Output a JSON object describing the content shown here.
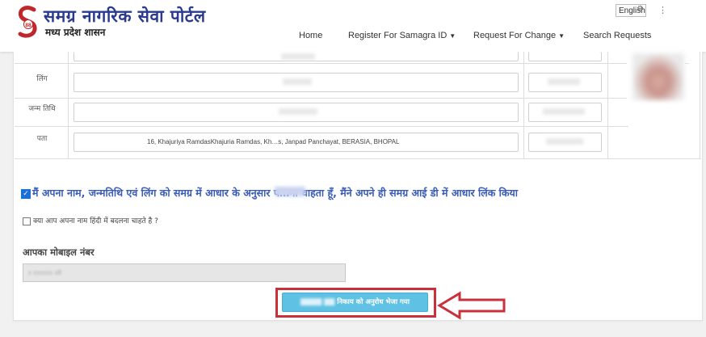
{
  "header": {
    "title": "समग्र नागरिक सेवा पोर्टल",
    "subtitle": "मध्य प्रदेश शासन",
    "logo_text": "88",
    "language_button": "English"
  },
  "nav": {
    "items": [
      {
        "label": "Home"
      },
      {
        "label": "Register For Samagra ID"
      },
      {
        "label": "Request For Change"
      },
      {
        "label": "Search Requests"
      }
    ]
  },
  "form": {
    "rows": [
      {
        "label": "लिंग"
      },
      {
        "label": "जन्म तिथि"
      },
      {
        "label": "पता",
        "value": "16, Khajuriya RamdasKhajuria Ramdas, Kh…s, Janpad Panchayat, BERASIA, BHOPAL"
      }
    ],
    "consent_text": "मैं अपना नाम, जन्मतिथि एवं लिंग को समग्र में आधार के अनुसार प…ना चाहता हूँ, मैंने अपने ही समग्र आई डी में आधार लिंक किया",
    "hindi_question": "क्या आप अपना नाम हिंदी में बदलना चाहते है ?",
    "mobile_label": "आपका मोबाइल नंबर",
    "mobile_value": "x xxxxxx x8",
    "submit_label": "निकाय को अनुरोध भेजा गया"
  },
  "colors": {
    "highlight": "#c9303a",
    "button": "#5fc1e3",
    "consent": "#3a5cb8",
    "logo_red": "#c0272d"
  }
}
